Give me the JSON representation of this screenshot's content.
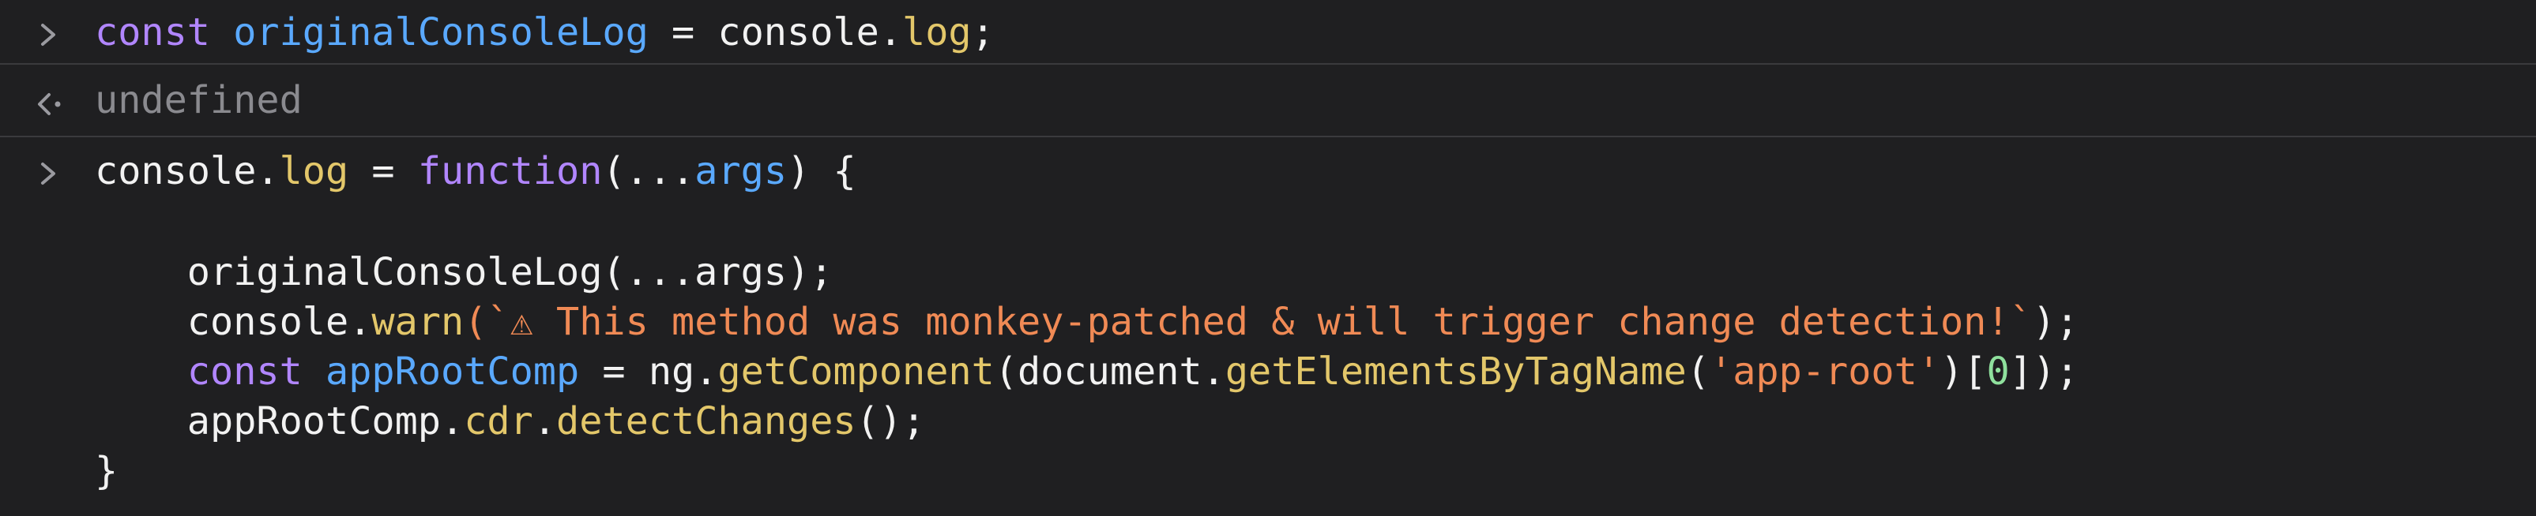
{
  "entries": [
    {
      "kind": "input",
      "lines": [
        [
          {
            "text": "const ",
            "cls": "kw"
          },
          {
            "text": "originalConsoleLog",
            "cls": "var"
          },
          {
            "text": " = console.",
            "cls": "plain"
          },
          {
            "text": "log",
            "cls": "prop"
          },
          {
            "text": ";",
            "cls": "plain"
          }
        ]
      ]
    },
    {
      "kind": "result",
      "text": "undefined"
    },
    {
      "kind": "input",
      "lines": [
        [
          {
            "text": "console.",
            "cls": "plain"
          },
          {
            "text": "log",
            "cls": "prop"
          },
          {
            "text": " = ",
            "cls": "plain"
          },
          {
            "text": "function",
            "cls": "kw"
          },
          {
            "text": "(...",
            "cls": "plain"
          },
          {
            "text": "args",
            "cls": "var"
          },
          {
            "text": ") {",
            "cls": "plain"
          }
        ],
        [],
        [
          {
            "text": "    originalConsoleLog(...args);",
            "cls": "plain"
          }
        ],
        [
          {
            "text": "    console.",
            "cls": "plain"
          },
          {
            "text": "warn",
            "cls": "prop"
          },
          {
            "text": "(`⚠ This method was monkey-patched & will trigger change detection!`",
            "cls": "str"
          },
          {
            "text": ");",
            "cls": "plain"
          }
        ],
        [
          {
            "text": "    ",
            "cls": "plain"
          },
          {
            "text": "const ",
            "cls": "kw"
          },
          {
            "text": "appRootComp",
            "cls": "var"
          },
          {
            "text": " = ng.",
            "cls": "plain"
          },
          {
            "text": "getComponent",
            "cls": "prop"
          },
          {
            "text": "(document.",
            "cls": "plain"
          },
          {
            "text": "getElementsByTagName",
            "cls": "prop"
          },
          {
            "text": "(",
            "cls": "plain"
          },
          {
            "text": "'app-root'",
            "cls": "str"
          },
          {
            "text": ")[",
            "cls": "plain"
          },
          {
            "text": "0",
            "cls": "num"
          },
          {
            "text": "]);",
            "cls": "plain"
          }
        ],
        [
          {
            "text": "    appRootComp.",
            "cls": "plain"
          },
          {
            "text": "cdr",
            "cls": "prop"
          },
          {
            "text": ".",
            "cls": "plain"
          },
          {
            "text": "detectChanges",
            "cls": "prop"
          },
          {
            "text": "();",
            "cls": "plain"
          }
        ],
        [
          {
            "text": "}",
            "cls": "plain"
          }
        ]
      ]
    }
  ],
  "icons": {
    "input_prompt": "chevron-right-icon",
    "result_prompt": "return-arrow-icon"
  },
  "colors": {
    "background": "#1f1f21",
    "keyword": "#b186ff",
    "identifier": "#5aa9ff",
    "property": "#e3c76a",
    "string": "#f08a55",
    "number": "#8fe09d",
    "muted": "#8a8a8f"
  }
}
